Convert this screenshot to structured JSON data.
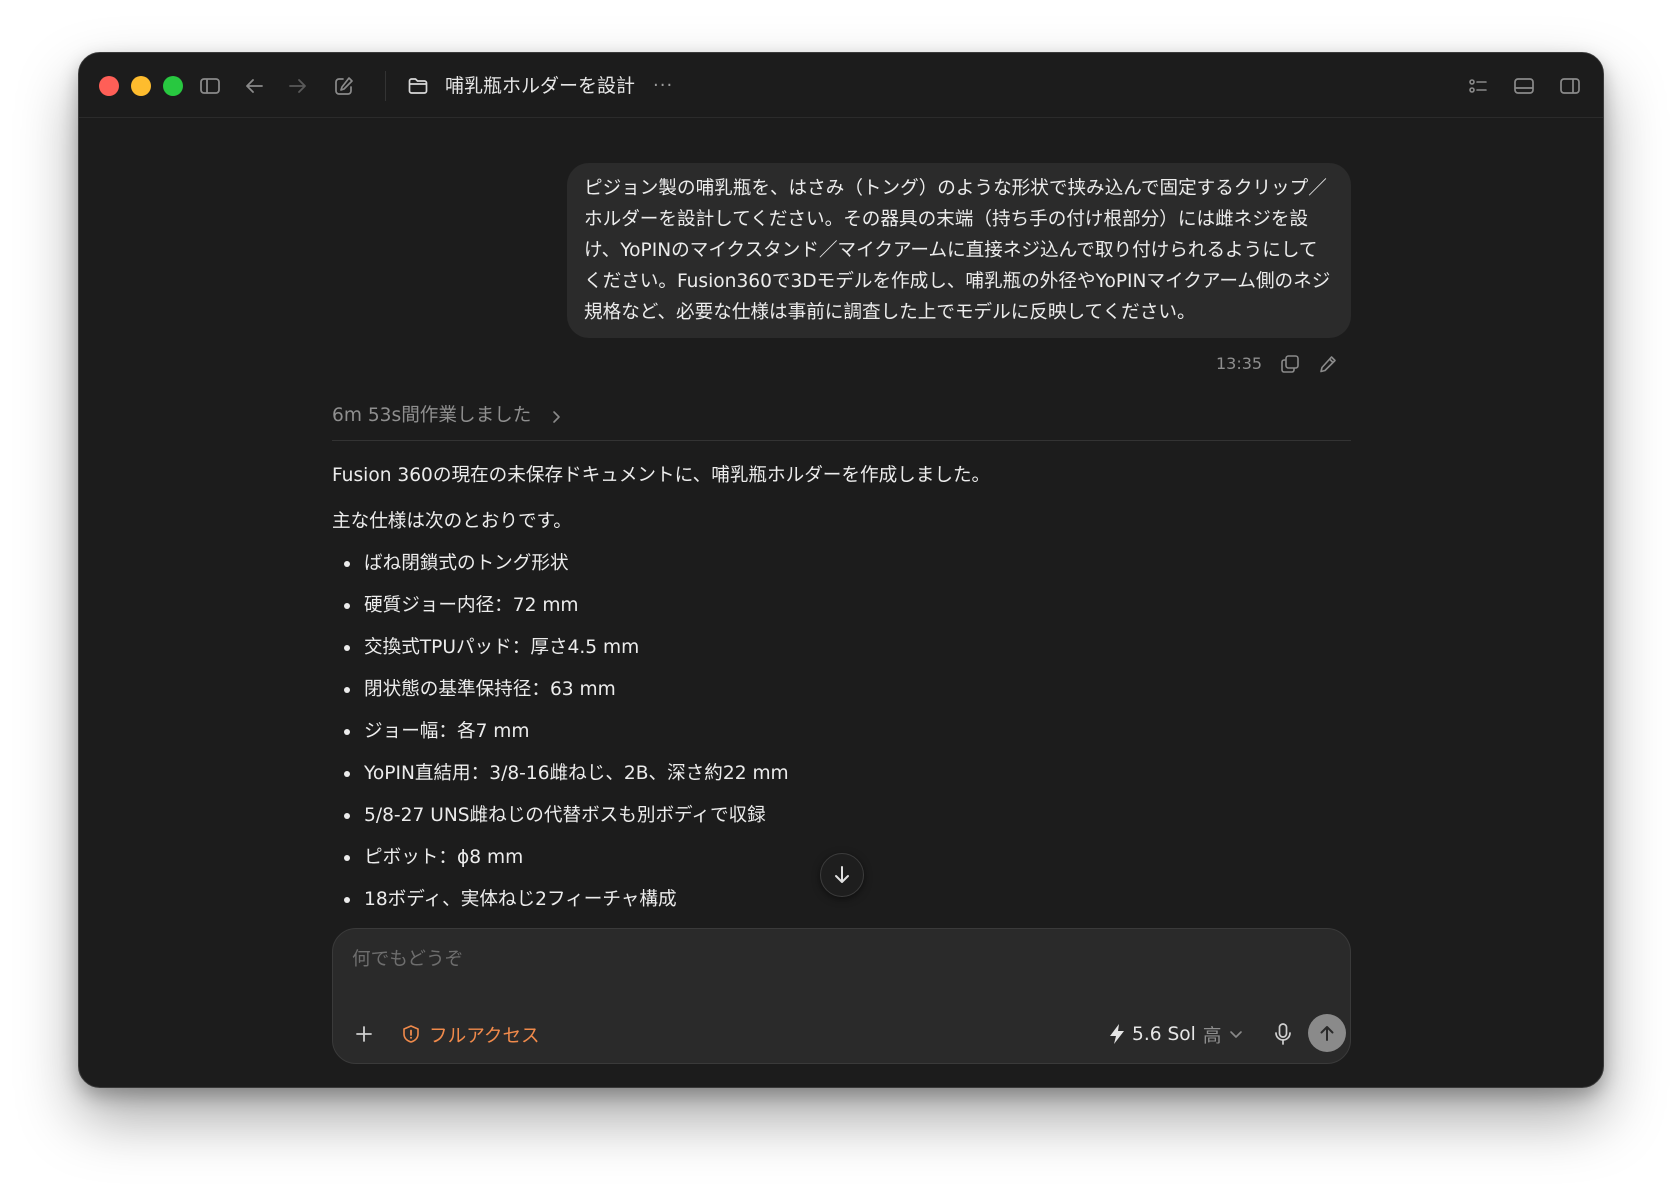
{
  "window": {
    "title": "哺乳瓶ホルダーを設計",
    "more": "···"
  },
  "conversation": {
    "user_message": {
      "text": "ピジョン製の哺乳瓶を、はさみ（トング）のような形状で挟み込んで固定するクリップ／ホルダーを設計してください。その器具の末端（持ち手の付け根部分）には雌ネジを設け、YoPINのマイクスタンド／マイクアームに直接ネジ込んで取り付けられるようにしてください。Fusion360で3Dモデルを作成し、哺乳瓶の外径やYoPINマイクアーム側のネジ規格など、必要な仕様は事前に調査した上でモデルに反映してください。",
      "time": "13:35"
    },
    "work_summary": "6m 53s間作業しました",
    "assistant": {
      "intro": "Fusion 360の現在の未保存ドキュメントに、哺乳瓶ホルダーを作成しました。",
      "spec_heading": "主な仕様は次のとおりです。",
      "specs": [
        "ばね閉鎖式のトング形状",
        "硬質ジョー内径：72 mm",
        "交換式TPUパッド：厚さ4.5 mm",
        "閉状態の基準保持径：63 mm",
        "ジョー幅：各7 mm",
        "YoPIN直結用：3/8-16雌ねじ、2B、深さ約22 mm",
        "5/8-27 UNS雌ねじの代替ボスも別ボディで収録",
        "ピボット：ϕ8 mm",
        "18ボディ、実体ねじ2フィーチャ構成"
      ]
    }
  },
  "composer": {
    "placeholder": "何でもどうぞ",
    "access_label": "フルアクセス",
    "model_label": "5.6 Sol",
    "effort_label": "高"
  },
  "colors": {
    "window_bg": "#1c1c1c",
    "bubble_bg": "#2b2b2b",
    "composer_bg": "#2a2a2a",
    "accent_orange": "#f08a4b",
    "send_button": "#8a8a8a"
  },
  "icons": {
    "sidebar_toggle": "sidebar-icon",
    "back": "arrow-left-icon",
    "forward": "arrow-right-icon",
    "new_chat": "compose-icon",
    "folder": "folder-icon",
    "checklist": "checklist-icon",
    "terminal": "terminal-panel-icon",
    "right_panel": "right-panel-icon",
    "copy": "copy-icon",
    "edit": "pencil-icon",
    "plus": "plus-icon",
    "warning": "warning-icon",
    "bolt": "bolt-icon",
    "mic": "microphone-icon",
    "send": "arrow-up-icon",
    "scroll_down": "arrow-down-icon"
  }
}
